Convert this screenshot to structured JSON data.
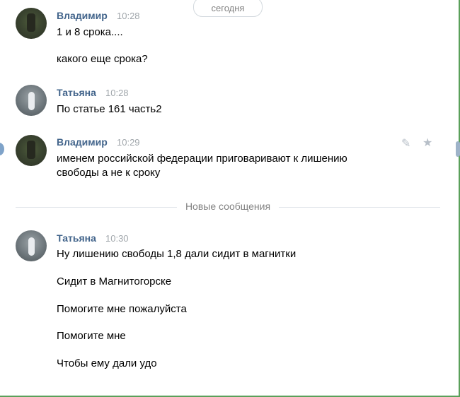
{
  "date_divider": "сегодня",
  "new_messages_divider": "Новые сообщения",
  "blocks": [
    {
      "author": "Владимир",
      "time": "10:28",
      "messages": [
        "1 и 8 срока....",
        "какого еще срока?"
      ]
    },
    {
      "author": "Татьяна",
      "time": "10:28",
      "messages": [
        "По статье 161 часть2"
      ]
    },
    {
      "author": "Владимир",
      "time": "10:29",
      "messages": [
        "именем российской федерации приговаривают к лишению свободы а не к сроку"
      ]
    },
    {
      "author": "Татьяна",
      "time": "10:30",
      "messages": [
        "Ну лишению свободы 1,8 дали сидит в магнитки",
        "Сидит в Магнитогорске",
        "Помогите мне пожалуйста",
        "Помогите мне",
        "Чтобы ему дали удо"
      ]
    }
  ],
  "icons": {
    "edit": "pencil-icon",
    "favorite": "star-icon"
  },
  "colors": {
    "author_name": "#42648b",
    "time": "#a0a6ab",
    "divider_text": "#828282",
    "frame_border": "#5aa05a"
  }
}
